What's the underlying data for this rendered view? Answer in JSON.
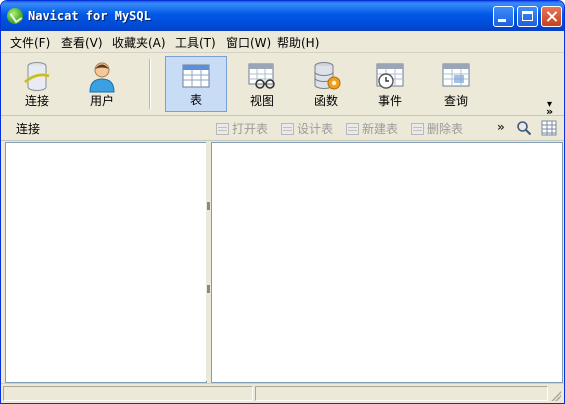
{
  "window": {
    "title": "Navicat for MySQL"
  },
  "menu": [
    {
      "label": "文件(F)"
    },
    {
      "label": "查看(V)"
    },
    {
      "label": "收藏夹(A)"
    },
    {
      "label": "工具(T)"
    },
    {
      "label": "窗口(W)"
    },
    {
      "label": "帮助(H)"
    }
  ],
  "toolbar": {
    "buttons": [
      {
        "label": "连接",
        "icon": "connection-icon"
      },
      {
        "label": "用户",
        "icon": "user-icon"
      },
      {
        "label": "表",
        "icon": "table-icon",
        "active": true
      },
      {
        "label": "视图",
        "icon": "view-icon"
      },
      {
        "label": "函数",
        "icon": "function-icon"
      },
      {
        "label": "事件",
        "icon": "event-icon"
      },
      {
        "label": "查询",
        "icon": "query-icon"
      }
    ],
    "overflow": "»"
  },
  "object_bar": {
    "title": "连接",
    "actions": [
      {
        "label": "打开表",
        "enabled": false
      },
      {
        "label": "设计表",
        "enabled": false
      },
      {
        "label": "新建表",
        "enabled": false
      },
      {
        "label": "删除表",
        "enabled": false
      }
    ],
    "overflow": "»"
  },
  "colors": {
    "titlebar": "#0058e6",
    "chrome": "#ece9d8",
    "active_button": "#c8dcf5"
  }
}
